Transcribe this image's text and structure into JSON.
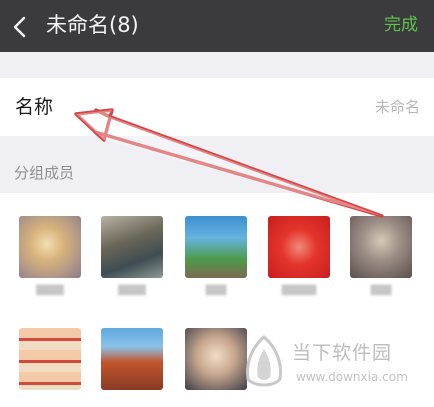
{
  "header": {
    "back_icon": "chevron-left-icon",
    "title": "未命名(8)",
    "done_label": "完成",
    "done_color": "#5fc24c",
    "bar_color": "#3b3b3d"
  },
  "name_row": {
    "label": "名称",
    "value": "未命名"
  },
  "members_section": {
    "header": "分组成员",
    "members": [
      {
        "avatar": "member-avatar-1"
      },
      {
        "avatar": "member-avatar-2"
      },
      {
        "avatar": "member-avatar-3"
      },
      {
        "avatar": "member-avatar-4"
      },
      {
        "avatar": "member-avatar-5"
      },
      {
        "avatar": "member-avatar-6"
      },
      {
        "avatar": "member-avatar-7"
      },
      {
        "avatar": "member-avatar-8"
      }
    ]
  },
  "annotation": {
    "type": "red-arrow",
    "color": "#d64545"
  },
  "watermark": {
    "title": "当下软件园",
    "url": "www.downxia.com"
  }
}
